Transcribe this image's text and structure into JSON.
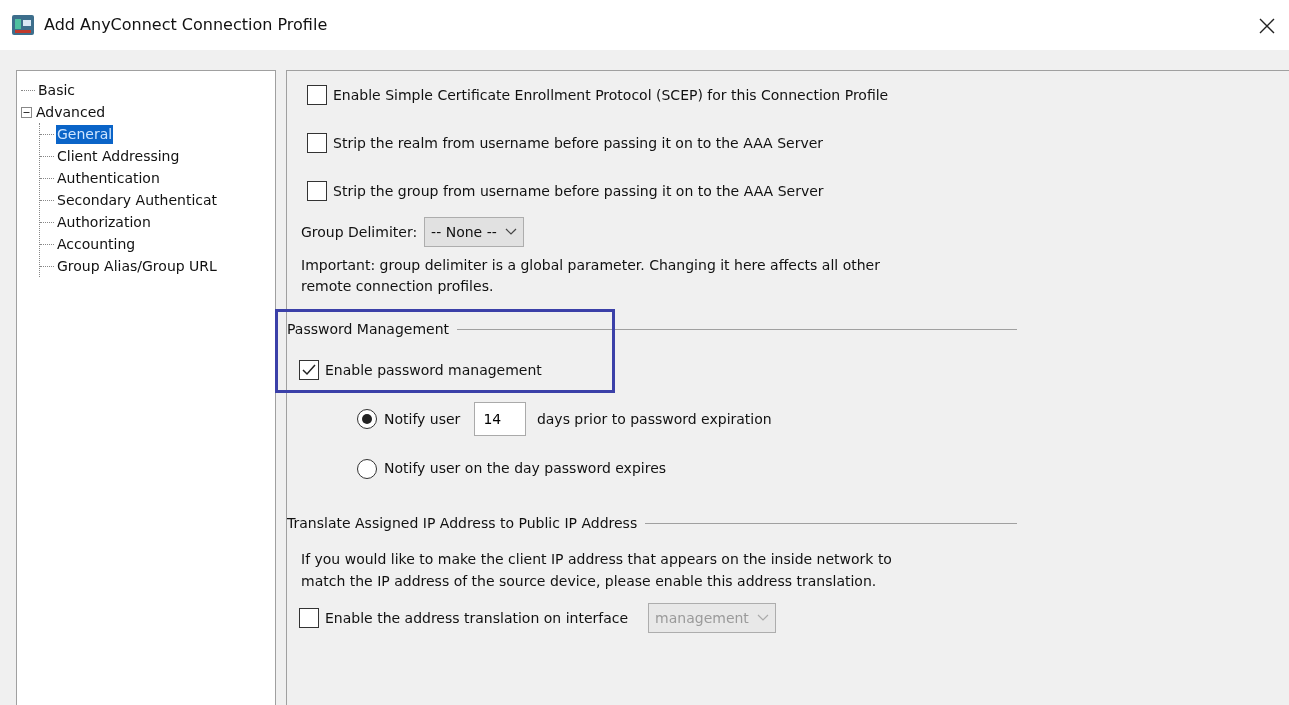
{
  "window": {
    "title": "Add AnyConnect Connection Profile"
  },
  "tree": [
    {
      "label": "Basic",
      "selected": false
    },
    {
      "label": "Advanced",
      "selected": false,
      "expanded": true,
      "children": [
        {
          "label": "General",
          "selected": true
        },
        {
          "label": "Client Addressing",
          "selected": false
        },
        {
          "label": "Authentication",
          "selected": false
        },
        {
          "label": "Secondary Authenticat",
          "selected": false
        },
        {
          "label": "Authorization",
          "selected": false
        },
        {
          "label": "Accounting",
          "selected": false
        },
        {
          "label": "Group Alias/Group URL",
          "selected": false
        }
      ]
    }
  ],
  "options": [
    {
      "label": "Enable Simple Certificate Enrollment Protocol (SCEP) for this Connection Profile",
      "checked": false
    },
    {
      "label": "Strip the realm from username before passing it on to the AAA Server",
      "checked": false
    },
    {
      "label": "Strip the group from username before passing it on to the AAA Server",
      "checked": false
    }
  ],
  "group_delimiter": {
    "label": "Group Delimiter:",
    "value": "-- None --",
    "disabled": false
  },
  "note": "Important: group delimiter is a global parameter. Changing it here affects all other remote connection profiles.",
  "password_management": {
    "title": "Password Management",
    "highlighted": true,
    "enable": {
      "label": "Enable password management",
      "checked": true
    },
    "notify_days": {
      "label": "Notify user",
      "value": "14",
      "suffix": "days prior to password expiration",
      "selected": true
    },
    "notify_on_day": {
      "label": "Notify user on the day password expires",
      "selected": false
    }
  },
  "translate": {
    "title": "Translate Assigned IP Address to Public IP Address",
    "text": "If you would like to make the client IP address that appears on the inside network to match the IP address of the source device, please enable this address translation.",
    "enable": {
      "label": "Enable the address translation on interface",
      "checked": false
    },
    "interface": {
      "value": "management",
      "disabled": true
    }
  }
}
